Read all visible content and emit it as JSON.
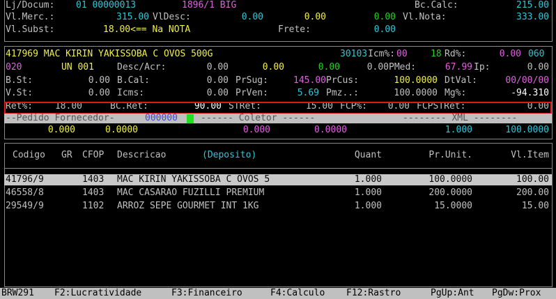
{
  "header": {
    "lj_docum_label": "Lj/Docum:",
    "lj_docum_value": "01 00000013",
    "doc_ref": "1896/1 BIG",
    "bc_calc_label": "Bc.Calc:",
    "bc_calc_value": "215.00",
    "vl_merc_label": "Vl.Merc.:",
    "vl_merc_value": "315.00",
    "vl_desc_label": "VlDesc:",
    "vl_desc_value": "0.00",
    "vl_desc_value2": "0.00",
    "vl_desc_value3": "0.00",
    "vl_nota_label": "Vl.Nota:",
    "vl_nota_value": "333.00",
    "vl_subst_label": "Vl.Subst:",
    "vl_subst_value": "18.00<== Na NOTA",
    "frete_label": "Frete:",
    "frete_value": "0.00"
  },
  "item": {
    "line1_code_desc": "417969 MAC KIRIN YAKISSOBA C OVOS 500G",
    "line1_ncm": "30103",
    "line1_icm_label": "Icm%:",
    "line1_icm_value": "00",
    "line1_rd_prefix": "18",
    "line1_rd_label": "Rd%:",
    "line1_rd_value": "0.00",
    "line1_trail": "060",
    "line2_code": "020",
    "line2_un": "UN 001",
    "line2_desc_label": "Desc/Acr:",
    "line2_v1": "0.00",
    "line2_v2": "0.00",
    "line2_v3": "0.00",
    "line2_v4": "0.00",
    "line2_pmed_label": "PMed:",
    "line2_pmed_value": "67.99",
    "line2_ip_label": "Ip:",
    "line2_ip_value": "0.00",
    "line3_bst_label": "B.St:",
    "line3_bst_value": "0.00",
    "line3_bcal_label": "B.Cal:",
    "line3_bcal_value": "0.00",
    "line3_prsug_label": "PrSug:",
    "line3_prsug_value": "145.00",
    "line3_prcus_label": "PrCus:",
    "line3_prcus_value": "100.0000",
    "line3_dtval_label": "DtVal:",
    "line3_dtval_value": "00/00/00",
    "line4_vst_label": "V.St:",
    "line4_vst_value": "0.00",
    "line4_icms_label": "Icms:",
    "line4_icms_value": "0.00",
    "line4_prven_label": "PrVen:",
    "line4_prven_value": "5.69",
    "line4_pmz_label": "Pmz..:",
    "line4_pmz_value": "100.0000",
    "line4_mg_label": "Mg%:",
    "line4_mg_value": "-94.310",
    "line5_ret_label": "Ret%:",
    "line5_ret_value": "18.00",
    "line5_bcret_label": "BC.Ret:",
    "line5_bcret_value": "90.00",
    "line5_stret_label": "STRet:",
    "line5_stret_value": "15.00",
    "line5_fcp_label": "FCP%:",
    "line5_fcp_value": "0.00",
    "line5_fcpst_label": "FCPSTRet:",
    "line5_fcpst_value": "0.00"
  },
  "bar": {
    "pedido_label": "--Pedido Fornecedor-",
    "pedido_code": "000000",
    "coletor_label": "------ Coletor ------",
    "xml_label": "-------- XML --------",
    "pedido_v1": "0.000",
    "pedido_v2": "0.0000",
    "coletor_v1": "0.000",
    "coletor_v2": "0.0000",
    "xml_v1": "1.000",
    "xml_v2": "100.0000"
  },
  "table": {
    "col_codigo": "Codigo",
    "col_gr": "GR",
    "col_cfop": "CFOP",
    "col_descricao": "Descricao",
    "col_deposito": "(Deposito)",
    "col_quant": "Quant",
    "col_pr_unit": "Pr.Unit.",
    "col_vl_item": "Vl.Item",
    "rows": [
      {
        "codigo": "41796/9",
        "cfop": "1403",
        "descricao": "MAC KIRIN YAKISSOBA C OVOS 5",
        "quant": "1.000",
        "pr_unit": "100.0000",
        "vl_item": "100.00"
      },
      {
        "codigo": "46558/8",
        "cfop": "1403",
        "descricao": "MAC CASARAO FUZILLI PREMIUM",
        "quant": "1.000",
        "pr_unit": "200.0000",
        "vl_item": "200.00"
      },
      {
        "codigo": "29549/9",
        "cfop": "1102",
        "descricao": "ARROZ SEPE GOURMET INT 1KG",
        "quant": "1.000",
        "pr_unit": "15.0000",
        "vl_item": "15.00"
      }
    ]
  },
  "status": {
    "program": "BRW291",
    "f2": "F2:Lucratividade",
    "f3": "F3:Financeiro",
    "f4": "F4:Calculo",
    "f12": "F12:Rastro",
    "pgup": "PgUp:Ant",
    "pgdw": "PgDw:Prox"
  }
}
